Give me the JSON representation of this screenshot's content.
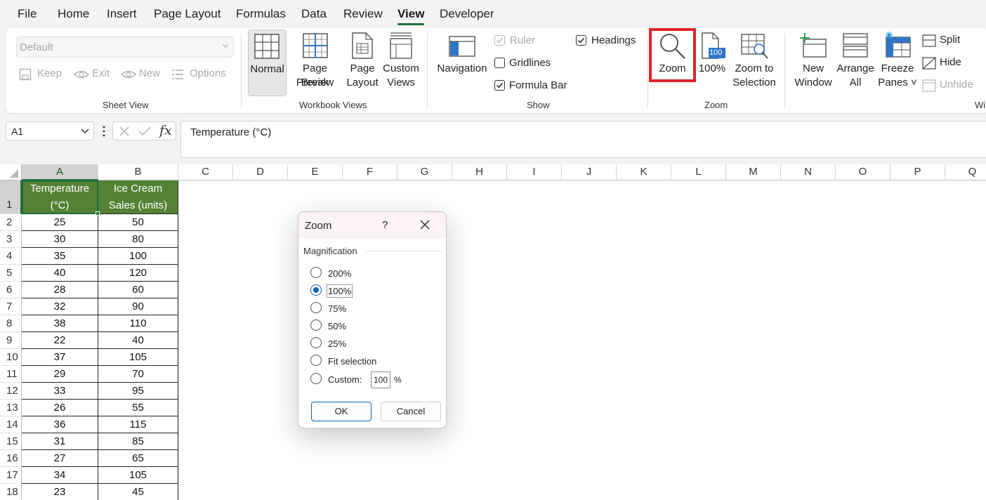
{
  "menu": {
    "tabs": [
      "File",
      "Home",
      "Insert",
      "Page Layout",
      "Formulas",
      "Data",
      "Review",
      "View",
      "Developer"
    ],
    "active": "View"
  },
  "ribbon": {
    "sheet_view": {
      "group_label": "Sheet View",
      "select_value": "Default",
      "keep": "Keep",
      "exit": "Exit",
      "new": "New",
      "options": "Options"
    },
    "workbook_views": {
      "group_label": "Workbook Views",
      "normal": "Normal",
      "page_break_line1": "Page Break",
      "page_break_line2": "Preview",
      "page_layout_line1": "Page",
      "page_layout_line2": "Layout",
      "custom_views_line1": "Custom",
      "custom_views_line2": "Views"
    },
    "show": {
      "group_label": "Show",
      "navigation": "Navigation",
      "ruler": "Ruler",
      "gridlines": "Gridlines",
      "formula_bar": "Formula Bar",
      "headings": "Headings"
    },
    "zoom": {
      "group_label": "Zoom",
      "zoom": "Zoom",
      "hundred": "100%",
      "icon_number": "100",
      "zoom_sel_line1": "Zoom to",
      "zoom_sel_line2": "Selection"
    },
    "window": {
      "group_label": "Wi",
      "new_window_line1": "New",
      "new_window_line2": "Window",
      "arrange_line1": "Arrange",
      "arrange_line2": "All",
      "freeze_line1": "Freeze",
      "freeze_line2": "Panes ˅",
      "split": "Split",
      "hide": "Hide",
      "unhide": "Unhide"
    }
  },
  "formula_bar": {
    "name_box": "A1",
    "fx": "fx",
    "content": "Temperature (°C)"
  },
  "grid": {
    "columns": [
      "A",
      "B",
      "C",
      "D",
      "E",
      "F",
      "G",
      "H",
      "I",
      "J",
      "K",
      "L",
      "M",
      "N",
      "O",
      "P",
      "Q"
    ],
    "rows": [
      "1",
      "2",
      "3",
      "4",
      "5",
      "6",
      "7",
      "8",
      "9",
      "10",
      "11",
      "12",
      "13",
      "14",
      "15",
      "16",
      "17",
      "18"
    ],
    "header": {
      "a_line1": "Temperature",
      "a_line2": "(°C)",
      "b_line1": "Ice Cream",
      "b_line2": "Sales (units)"
    },
    "data": [
      [
        "25",
        "50"
      ],
      [
        "30",
        "80"
      ],
      [
        "35",
        "100"
      ],
      [
        "40",
        "120"
      ],
      [
        "28",
        "60"
      ],
      [
        "32",
        "90"
      ],
      [
        "38",
        "110"
      ],
      [
        "22",
        "40"
      ],
      [
        "37",
        "105"
      ],
      [
        "29",
        "70"
      ],
      [
        "33",
        "95"
      ],
      [
        "26",
        "55"
      ],
      [
        "36",
        "115"
      ],
      [
        "31",
        "85"
      ],
      [
        "27",
        "65"
      ],
      [
        "34",
        "105"
      ],
      [
        "23",
        "45"
      ]
    ]
  },
  "dialog": {
    "title": "Zoom",
    "help": "?",
    "section": "Magnification",
    "options": [
      "200%",
      "100%",
      "75%",
      "50%",
      "25%",
      "Fit selection",
      "Custom:"
    ],
    "selected": "100%",
    "custom_value": "100",
    "percent_sign": "%",
    "ok": "OK",
    "cancel": "Cancel"
  },
  "colors": {
    "accent_green": "#1e6e3c",
    "header_fill": "#548235",
    "highlight_red": "#e0242c",
    "dialog_blue": "#0f5fc3"
  }
}
